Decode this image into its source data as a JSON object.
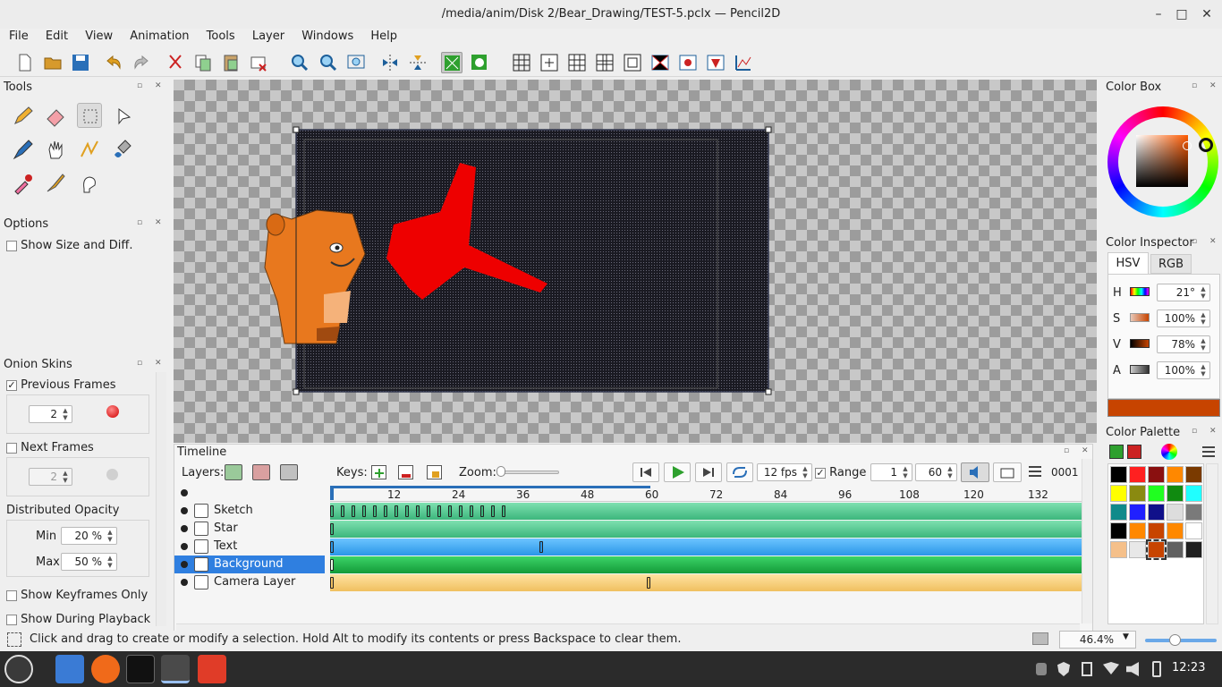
{
  "window": {
    "title": "/media/anim/Disk 2/Bear_Drawing/TEST-5.pclx — Pencil2D",
    "minimize": "–",
    "maximize": "□",
    "close": "✕"
  },
  "menu": [
    "File",
    "Edit",
    "View",
    "Animation",
    "Tools",
    "Layer",
    "Windows",
    "Help"
  ],
  "tools_panel": {
    "title": "Tools"
  },
  "options_panel": {
    "title": "Options",
    "show_size_diff": "Show Size and Diff."
  },
  "onion_panel": {
    "title": "Onion Skins",
    "previous_frames": "Previous Frames",
    "previous_value": "2",
    "next_frames": "Next Frames",
    "next_value": "2",
    "distributed_opacity": "Distributed Opacity",
    "min_label": "Min",
    "min_value": "20 %",
    "max_label": "Max",
    "max_value": "50 %",
    "show_keyframes_only": "Show Keyframes Only",
    "show_during_playback": "Show During Playback"
  },
  "timeline": {
    "title": "Timeline",
    "layers_label": "Layers:",
    "keys_label": "Keys:",
    "zoom_label": "Zoom:",
    "fps": "12 fps",
    "range_label": "Range",
    "range_start": "1",
    "range_end": "60",
    "frame_counter": "0001",
    "ruler": [
      "12",
      "24",
      "36",
      "48",
      "60",
      "72",
      "84",
      "96",
      "108",
      "120",
      "132"
    ],
    "layers": [
      {
        "name": "Sketch",
        "color": "#5ed39b"
      },
      {
        "name": "Star",
        "color": "#5ed39b"
      },
      {
        "name": "Text",
        "color": "#3aa6f0"
      },
      {
        "name": "Background",
        "color": "#22b84a"
      },
      {
        "name": "Camera Layer",
        "color": "#f6d07a"
      }
    ]
  },
  "color_box": {
    "title": "Color Box"
  },
  "color_inspector": {
    "title": "Color Inspector",
    "tab_hsv": "HSV",
    "tab_rgb": "RGB",
    "h_label": "H",
    "h_value": "21°",
    "s_label": "S",
    "s_value": "100%",
    "v_label": "V",
    "v_value": "78%",
    "a_label": "A",
    "a_value": "100%",
    "current_color": "#c74400"
  },
  "color_palette": {
    "title": "Color Palette",
    "swatches": [
      "#000000",
      "#ff2020",
      "#8a1010",
      "#ff8800",
      "#7a3a00",
      "#ffff00",
      "#8a8a10",
      "#20ff20",
      "#108a10",
      "#20ffff",
      "#108a8a",
      "#2020ff",
      "#10108a",
      "#dddddd",
      "#7a7a7a",
      "#000000",
      "#ff8800",
      "#c74400",
      "#ff8800",
      "#ffffff",
      "#f5c08a",
      "#e8e8e8",
      "#c74400",
      "#606060",
      "#202020"
    ]
  },
  "status": {
    "message": "Click and drag to create or modify a selection. Hold Alt to modify its contents or press Backspace to clear them.",
    "zoom": "46.4%"
  },
  "taskbar": {
    "clock": "12:23"
  }
}
